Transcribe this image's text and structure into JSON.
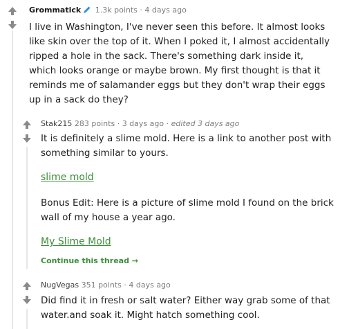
{
  "comments": [
    {
      "author": "Grommatick",
      "points": "1.3k points",
      "time": "4 days ago",
      "body": "I live in Washington, I've never seen this before. It almost looks like skin over the top of it. When I poked it, I almost accidentally ripped a hole in the sack. There's something dark inside it, which looks orange or maybe brown. My first thought is that it reminds me of salamander eggs but they don't wrap their eggs up in a sack do they?"
    },
    {
      "author": "Stak215",
      "points": "283 points",
      "time": "3 days ago",
      "edited": "edited 3 days ago",
      "body1": "It is definitely a slime mold. Here is a link to another post with something similar to yours.",
      "link1": "slime mold",
      "body2": "Bonus Edit: Here is a picture of slime mold I found on the brick wall of my house a year ago.",
      "link2": "My Slime Mold",
      "continue": "Continue this thread →"
    },
    {
      "author": "NugVegas",
      "points": "351 points",
      "time": "4 days ago",
      "body": "Did find it in fresh or salt water? Either way grab some of that water.and soak it. Might hatch something cool."
    }
  ],
  "separator": "·",
  "icons": {
    "upvote": "up-arrow-icon",
    "downvote": "down-arrow-icon",
    "flair": "pencil-icon"
  },
  "colors": {
    "link": "#3b8d3b",
    "meta": "#7c7c7c",
    "pencil": "#2f8fd8",
    "arrow": "#878a8c"
  }
}
